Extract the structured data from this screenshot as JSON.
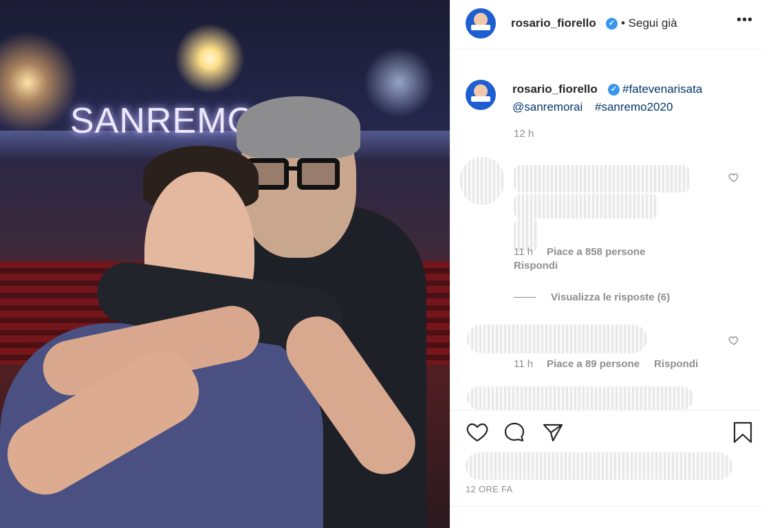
{
  "photo": {
    "stage_text": "SANREMO"
  },
  "post": {
    "username": "rosario_fiorello",
    "verified_icon": "verified-badge-icon",
    "follow_status": "• Segui già",
    "more_icon": "•••"
  },
  "caption": {
    "username": "rosario_fiorello",
    "hashtag1": "#fatevenarisata",
    "mention": "@sanremorai",
    "hashtag2": "#sanremo2020",
    "time": "12 h"
  },
  "comments": [
    {
      "time": "11 h",
      "likes": "Piace a 858 persone",
      "reply": "Rispondi",
      "view_replies": "Visualizza le risposte (6)"
    },
    {
      "time": "11 h",
      "likes": "Piace a 89 persone",
      "reply": "Rispondi"
    }
  ],
  "actions": {
    "like_icon": "heart-icon",
    "comment_icon": "comment-icon",
    "share_icon": "share-icon",
    "save_icon": "bookmark-icon"
  },
  "footer": {
    "timestamp": "12 ORE FA"
  },
  "colors": {
    "text": "#262626",
    "muted": "#8e8e8e",
    "link": "#00376b",
    "verified": "#3897f0"
  }
}
